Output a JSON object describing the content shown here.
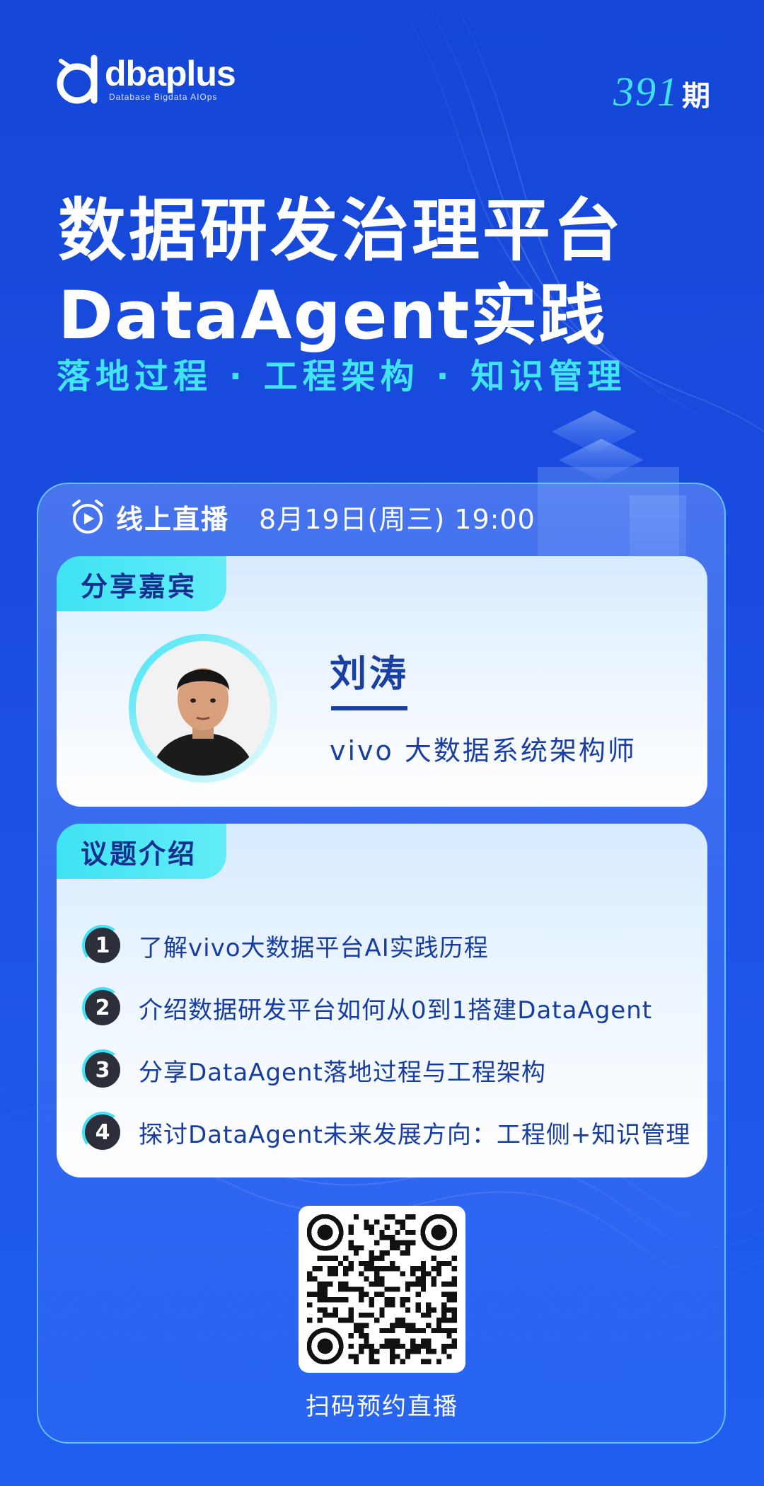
{
  "brand": {
    "name": "dbaplus",
    "tagline": "Database  Bigdata  AIOps"
  },
  "issue": {
    "number": "391",
    "unit": "期"
  },
  "title": {
    "line1": "数据研发治理平台",
    "line2": "DataAgent实践"
  },
  "subtitle": "落地过程 · 工程架构 · 知识管理",
  "live": {
    "icon": "alarm-play-icon",
    "label": "线上直播",
    "time": "8月19日(周三) 19:00"
  },
  "speaker_section": {
    "tab": "分享嘉宾",
    "name": "刘涛",
    "role": "vivo  大数据系统架构师"
  },
  "topics_section": {
    "tab": "议题介绍",
    "items": [
      {
        "num": "1",
        "text": "了解vivo大数据平台AI实践历程"
      },
      {
        "num": "2",
        "text": "介绍数据研发平台如何从0到1搭建DataAgent"
      },
      {
        "num": "3",
        "text": "分享DataAgent落地过程与工程架构"
      },
      {
        "num": "4",
        "text": "探讨DataAgent未来发展方向：工程侧+知识管理"
      }
    ]
  },
  "qr": {
    "caption": "扫码预约直播"
  },
  "colors": {
    "background": "#1a4be0",
    "accent_cyan": "#40e4f2",
    "text_navy": "#1a3fa3"
  }
}
